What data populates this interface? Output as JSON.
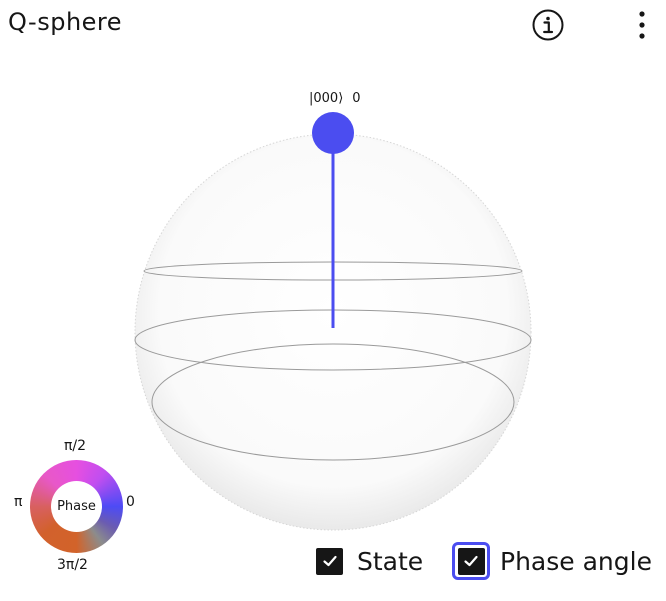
{
  "header": {
    "title": "Q-sphere",
    "info_icon": "info-icon",
    "menu_icon": "overflow-menu-vertical-icon"
  },
  "qsphere": {
    "state_label": "|000⟩",
    "state_amplitude": "0",
    "state_color": "#4b4df0"
  },
  "phase_legend": {
    "center_label": "Phase",
    "top": "π/2",
    "left": "π",
    "right": "0",
    "bottom": "3π/2"
  },
  "controls": {
    "state": {
      "label": "State",
      "checked": true
    },
    "phase_angle": {
      "label": "Phase angle",
      "checked": true,
      "focused": true
    }
  },
  "colors": {
    "accent": "#4b4df0",
    "text": "#161616"
  }
}
